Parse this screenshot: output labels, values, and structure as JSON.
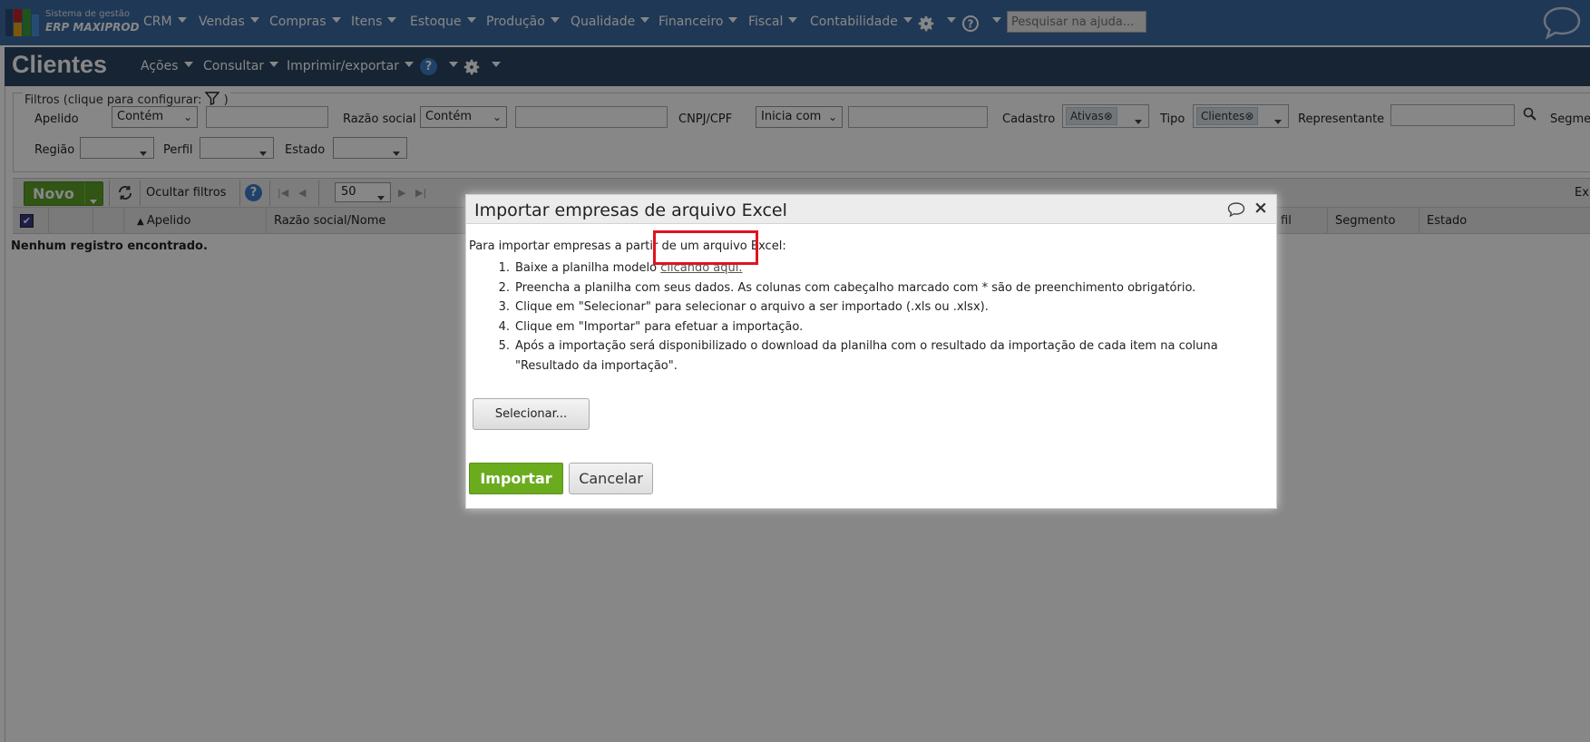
{
  "logo": {
    "line1": "Sistema de gestão",
    "line2": "ERP MAXIPROD"
  },
  "topnav": {
    "items": [
      "CRM",
      "Vendas",
      "Compras",
      "Itens",
      "Estoque",
      "Produção",
      "Qualidade",
      "Financeiro",
      "Fiscal",
      "Contabilidade"
    ],
    "search_placeholder": "Pesquisar na ajuda...",
    "help_glyph": "?"
  },
  "page": {
    "title": "Clientes",
    "menus": [
      "Ações",
      "Consultar",
      "Imprimir/exportar"
    ],
    "help_glyph": "?"
  },
  "filters": {
    "legend": "Filtros (clique para configurar:",
    "legend_close": ")",
    "apelido_label": "Apelido",
    "apelido_mode": "Contém",
    "razao_label": "Razão social",
    "razao_mode": "Contém",
    "cnpj_label": "CNPJ/CPF",
    "cnpj_mode": "Inicia com",
    "cadastro_label": "Cadastro",
    "cadastro_tag": "Ativas",
    "tipo_label": "Tipo",
    "tipo_tag": "Clientes",
    "representante_label": "Representante",
    "segmento_label_partial": "Segme",
    "regiao_label": "Região",
    "perfil_label": "Perfil",
    "estado_label": "Estado",
    "tag_remove_glyph": "⊗"
  },
  "toolbar": {
    "novo_label": "Novo",
    "ocultar_label": "Ocultar filtros",
    "help_glyph": "?",
    "per_page": "50",
    "right_partial": "Ex"
  },
  "grid": {
    "columns": [
      "Apelido",
      "Razão social/Nome",
      "fil",
      "Segmento",
      "Estado"
    ],
    "empty_message": "Nenhum registro encontrado.",
    "check_glyph": "✔"
  },
  "dialog": {
    "title": "Importar empresas de arquivo Excel",
    "close_glyph": "×",
    "intro": "Para importar empresas a partir de um arquivo Excel:",
    "steps": [
      {
        "num": "1.",
        "text": "Baixe a planilha modelo",
        "link": "clicando aqui."
      },
      {
        "num": "2.",
        "text": "Preencha a planilha com seus dados. As colunas com cabeçalho marcado com * são de preenchimento obrigatório."
      },
      {
        "num": "3.",
        "text": "Clique em \"Selecionar\" para selecionar o arquivo a ser importado (.xls ou .xlsx)."
      },
      {
        "num": "4.",
        "text": "Clique em \"Importar\" para efetuar a importação."
      },
      {
        "num": "5.",
        "text": "Após a importação será disponibilizado o download da planilha com o resultado da importação de cada item na coluna \"Resultado da importação\"."
      }
    ],
    "select_button": "Selecionar...",
    "import_button": "Importar",
    "cancel_button": "Cancelar"
  },
  "colors": {
    "nav_bg": "#3c6aa0",
    "header_bg": "#2b4560",
    "accent_green": "#6bac1f",
    "highlight_red": "#e0141e"
  }
}
